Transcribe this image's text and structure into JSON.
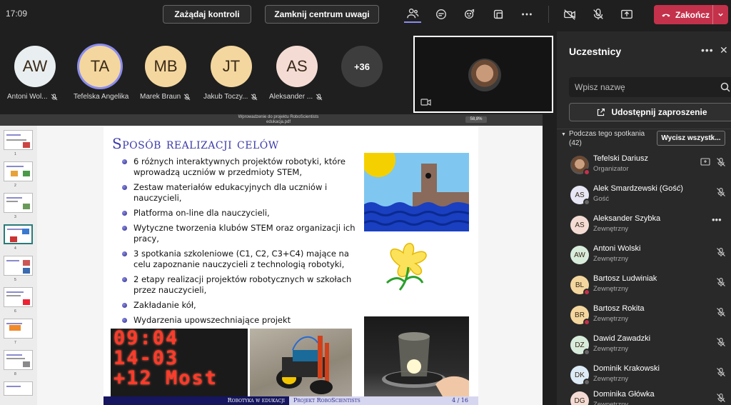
{
  "topbar": {
    "time": "17:09",
    "request_control": "Zażądaj kontroli",
    "stop_spotlight": "Zamknij centrum uwagi",
    "end_label": "Zakończ"
  },
  "gallery": {
    "tiles": [
      {
        "initials": "AW",
        "name": "Antoni Wol...",
        "color": "#e9eef0",
        "muted": true
      },
      {
        "initials": "TA",
        "name": "Tefelska Angelika",
        "color": "#f4d79e",
        "muted": false
      },
      {
        "initials": "MB",
        "name": "Marek Braun",
        "color": "#f4d79e",
        "muted": true
      },
      {
        "initials": "JT",
        "name": "Jakub Toczy...",
        "color": "#f4d79e",
        "muted": true
      },
      {
        "initials": "AS",
        "name": "Aleksander ...",
        "color": "#f4dcd5",
        "muted": true
      }
    ],
    "more_count": "+36"
  },
  "viewer": {
    "doc_title": "Wprowadzenie do projektu RoboScientists",
    "doc_file": "edukacja.pdf",
    "zoom": "58,8%"
  },
  "slide": {
    "title": "Sposób realizacji celów",
    "bullets": [
      "6 różnych interaktywnych projektów robotyki, które wprowadzą uczniów w przedmioty STEM,",
      "Zestaw materiałów edukacyjnych dla uczniów i nauczycieli,",
      "Platforma on-line dla nauczycieli,",
      "Wytyczne tworzenia klubów STEM oraz organizacji ich pracy,",
      "3 spotkania szkoleniowe (C1, C2, C3+C4) mające na celu zapoznanie nauczycieli z technologią robotyki,",
      "2 etapy realizacji projektów robotycznych w szkołach przez nauczycieli,",
      "Zakładanie kół,",
      "Wydarzenia upowszechniające projekt"
    ],
    "led_lines": [
      "09:04",
      "14-03",
      "+12 Most"
    ],
    "footer_left": "Robotyka w edukacji",
    "footer_right": "Projekt RoboScientists",
    "page": "4 / 16"
  },
  "thumbnails": [
    "1",
    "2",
    "3",
    "4",
    "5",
    "6",
    "7",
    "8"
  ],
  "panel": {
    "title": "Uczestnicy",
    "search_placeholder": "Wpisz nazwę",
    "invite_label": "Udostępnij zaproszenie",
    "section_label": "Podczas tego spotkania",
    "section_count": "(42)",
    "mute_all": "Wycisz wszystk...",
    "participants": [
      {
        "initials": "",
        "name": "Tefelski Dariusz",
        "role": "Organizator",
        "color": "#8a6a55",
        "photo": true,
        "muted": true
      },
      {
        "initials": "AS",
        "name": "Alek Smardzewski (Gość)",
        "role": "Gość",
        "color": "#e6e6f4",
        "muted": true
      },
      {
        "initials": "AS",
        "name": "Aleksander Szybka",
        "role": "Zewnętrzny",
        "color": "#f4dcd5",
        "muted": false
      },
      {
        "initials": "AW",
        "name": "Antoni Wolski",
        "role": "Zewnętrzny",
        "color": "#d8ecdc",
        "muted": true
      },
      {
        "initials": "BL",
        "name": "Bartosz Ludwiniak",
        "role": "Zewnętrzny",
        "color": "#f4d79e",
        "muted": true
      },
      {
        "initials": "BR",
        "name": "Bartosz Rokita",
        "role": "Zewnętrzny",
        "color": "#f4d79e",
        "muted": true
      },
      {
        "initials": "DZ",
        "name": "Dawid Zawadzki",
        "role": "Zewnętrzny",
        "color": "#d8ecdc",
        "muted": true
      },
      {
        "initials": "DK",
        "name": "Dominik Krakowski",
        "role": "Zewnętrzny",
        "color": "#dcebf6",
        "muted": true
      },
      {
        "initials": "DG",
        "name": "Dominika Główka",
        "role": "Zewnętrzny",
        "color": "#f4dcd5",
        "muted": true
      }
    ]
  },
  "colors": {
    "accent_red": "#c4314b",
    "slide_blue": "#3b3ba8",
    "panel_bg": "#292929"
  }
}
